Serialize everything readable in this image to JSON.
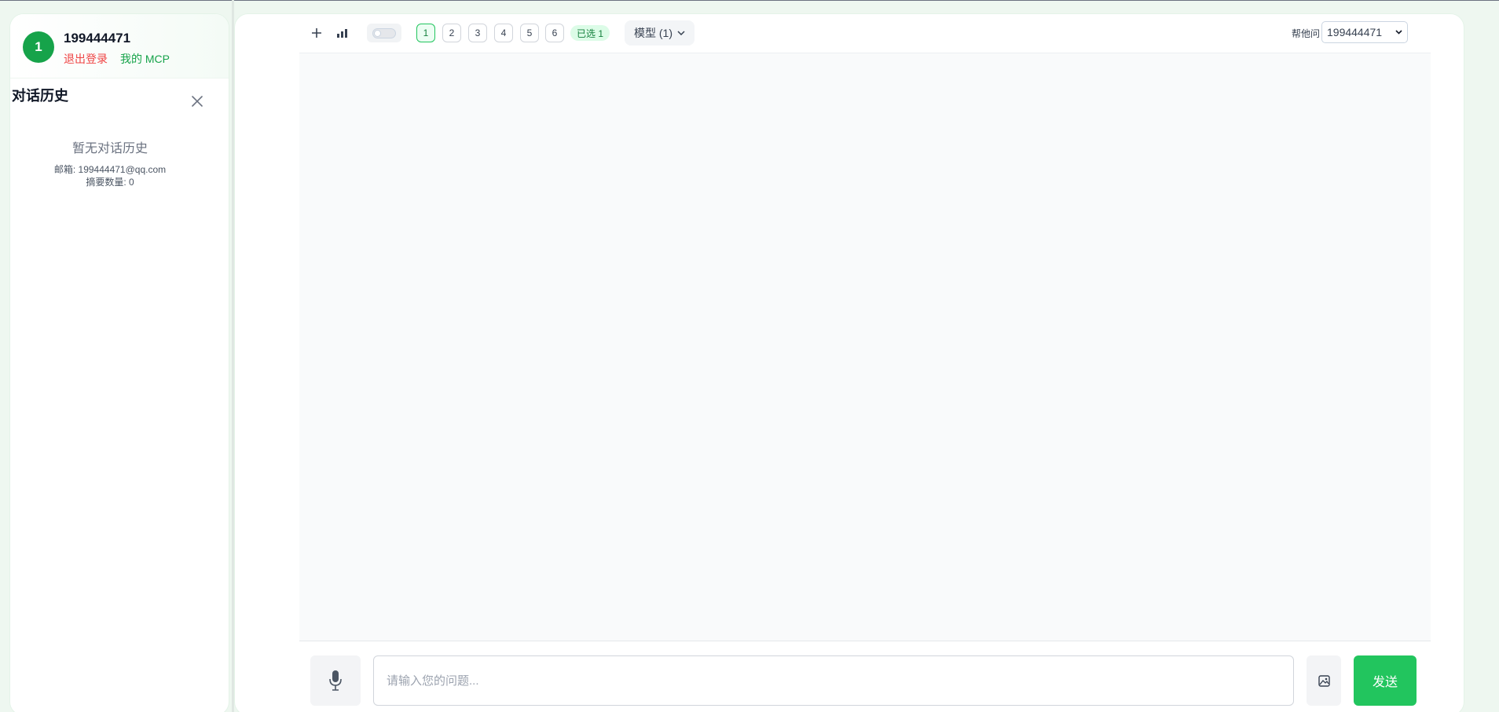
{
  "user": {
    "avatar_initial": "1",
    "name": "199444471",
    "logout_label": "退出登录",
    "mcp_label": "我的 MCP"
  },
  "history": {
    "title": "对话历史",
    "empty_text": "暂无对话历史",
    "email_line": "邮箱: 199444471@qq.com",
    "count_line": "摘要数量: 0"
  },
  "toolbar": {
    "number_buttons": [
      "1",
      "2",
      "3",
      "4",
      "5",
      "6"
    ],
    "active_number": "1",
    "selected_badge": "已选 1",
    "model_label": "模型 (1)",
    "help_label": "帮他问",
    "user_select_value": "199444471"
  },
  "composer": {
    "placeholder": "请输入您的问题...",
    "send_label": "发送"
  },
  "colors": {
    "accent": "#22c55e",
    "avatar": "#16a34a",
    "logout": "#ef4444"
  },
  "icons": {
    "new_chat": "plus-icon",
    "stats": "bar-chart-icon",
    "close": "close-icon",
    "model_dropdown": "chevron-down-icon",
    "mic": "microphone-icon",
    "image": "image-icon"
  }
}
